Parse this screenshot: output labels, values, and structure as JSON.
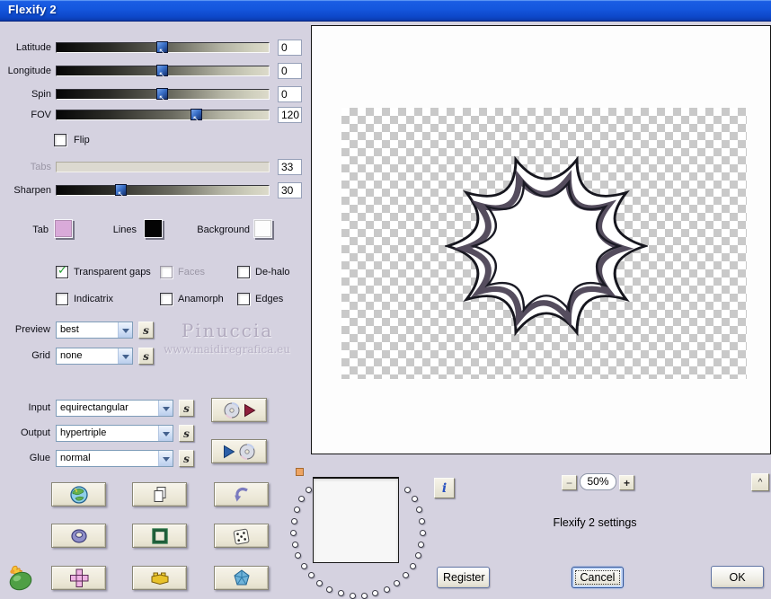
{
  "title": "Flexify 2",
  "colors": {
    "titlebar_blue": "#0d47c8",
    "dialog_bg": "#d5d2e0",
    "button_face": "#ece9d8",
    "tab_swatch": "#d9aad9",
    "lines_swatch": "#040404",
    "background_swatch": "#fdfdfd",
    "check_green": "#1f9e2e"
  },
  "sliders": [
    {
      "label": "Latitude",
      "value": "0",
      "pos": 49.5,
      "disabled": false
    },
    {
      "label": "Longitude",
      "value": "0",
      "pos": 49.5,
      "disabled": false
    },
    {
      "label": "Spin",
      "value": "0",
      "pos": 49.5,
      "disabled": false
    },
    {
      "label": "FOV",
      "value": "120",
      "pos": 65.5,
      "disabled": false
    },
    {
      "label": "Tabs",
      "value": "33",
      "pos": null,
      "disabled": true
    },
    {
      "label": "Sharpen",
      "value": "30",
      "pos": 30,
      "disabled": false
    }
  ],
  "flip": {
    "label": "Flip",
    "checked": false
  },
  "swatches": [
    {
      "label": "Tab",
      "color": "#d9aad9"
    },
    {
      "label": "Lines",
      "color": "#040404"
    },
    {
      "label": "Background",
      "color": "#fdfdfd"
    }
  ],
  "checkboxes": [
    {
      "label": "Transparent gaps",
      "checked": true,
      "disabled": false
    },
    {
      "label": "Faces",
      "checked": false,
      "disabled": true
    },
    {
      "label": "De-halo",
      "checked": false,
      "disabled": false
    },
    {
      "label": "Indicatrix",
      "checked": false,
      "disabled": false
    },
    {
      "label": "Anamorph",
      "checked": false,
      "disabled": false
    },
    {
      "label": "Edges",
      "checked": false,
      "disabled": false
    }
  ],
  "check_glyph": "✓",
  "selects_small": [
    {
      "label": "Preview",
      "value": "best"
    },
    {
      "label": "Grid",
      "value": "none"
    }
  ],
  "selects_large": [
    {
      "label": "Input",
      "value": "equirectangular"
    },
    {
      "label": "Output",
      "value": "hypertriple"
    },
    {
      "label": "Glue",
      "value": "normal"
    }
  ],
  "s_button": "s",
  "watermark": {
    "line1": "Pinuccia",
    "line2": "www.maidiregrafica.eu"
  },
  "icon_grid": [
    "globe",
    "copy",
    "undo",
    "torus",
    "frame",
    "dice",
    "cube-net",
    "brick",
    "polyhedron"
  ],
  "io_buttons": {
    "load_icons": [
      "cd",
      "play-red"
    ],
    "save_icons": [
      "play-blue",
      "cd"
    ]
  },
  "zoom_bar": {
    "minus": "−",
    "value": "50%",
    "plus": "+",
    "collapse": "^"
  },
  "info_button": "i",
  "status_text": "Flexify 2 settings",
  "action_buttons": {
    "register": "Register",
    "cancel": "Cancel",
    "ok": "OK"
  }
}
